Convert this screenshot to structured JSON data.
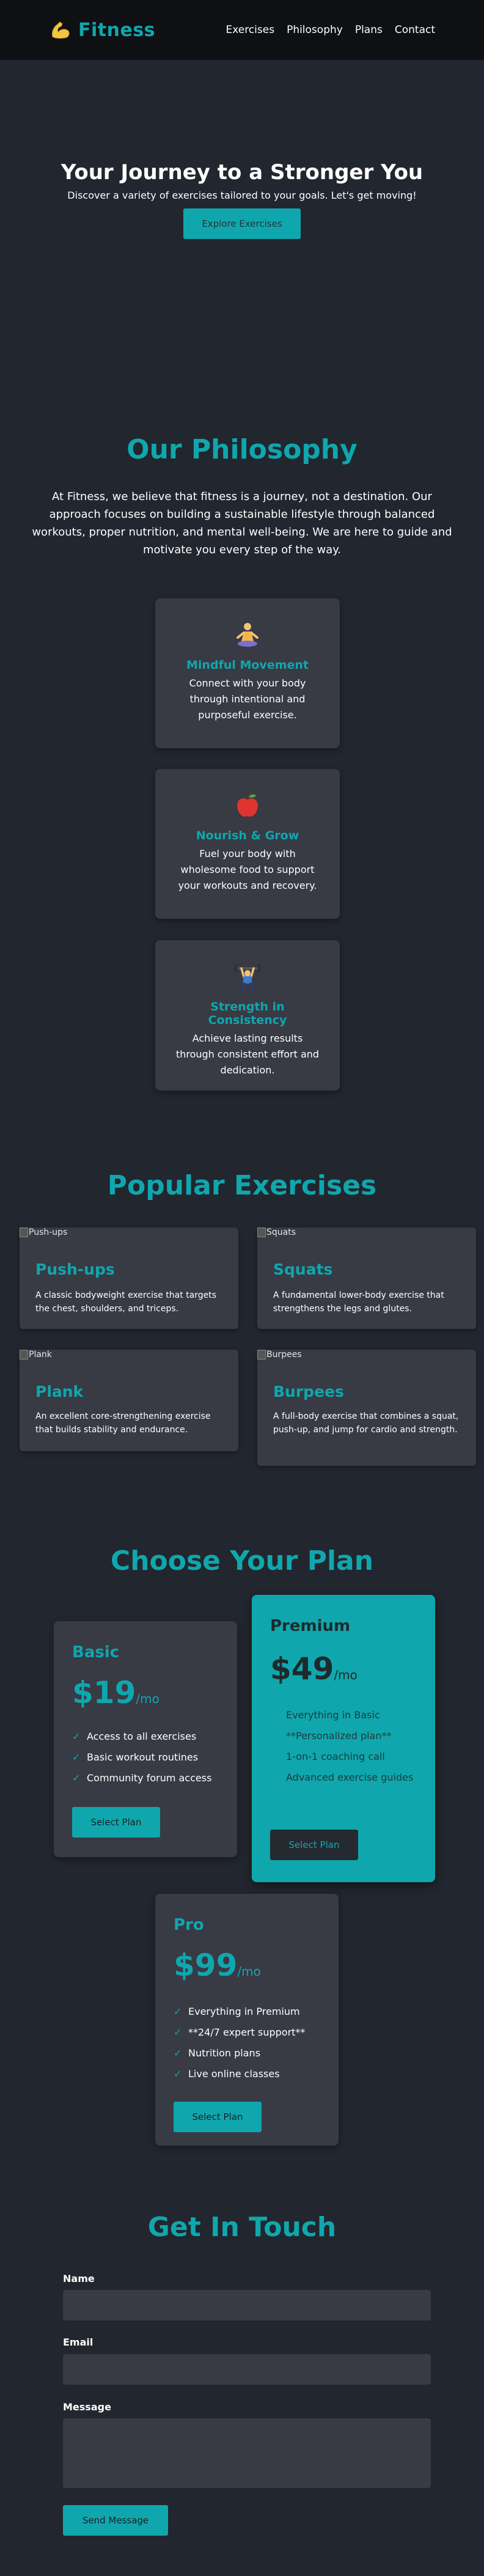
{
  "header": {
    "brand": "Fitness",
    "nav": [
      "Exercises",
      "Philosophy",
      "Plans",
      "Contact"
    ]
  },
  "hero": {
    "title": "Your Journey to a Stronger You",
    "subtitle": "Discover a variety of exercises tailored to your goals. Let's get moving!",
    "cta": "Explore Exercises"
  },
  "philosophy": {
    "title": "Our Philosophy",
    "intro": "At Fitness, we believe that fitness is a journey, not a destination. Our approach focuses on building a sustainable lifestyle through balanced workouts, proper nutrition, and mental well-being. We are here to guide and motivate you every step of the way.",
    "cards": [
      {
        "icon": "meditation-icon",
        "title": "Mindful Movement",
        "text": "Connect with your body through intentional and purposeful exercise."
      },
      {
        "icon": "apple-icon",
        "title": "Nourish & Grow",
        "text": "Fuel your body with wholesome food to support your workouts and recovery."
      },
      {
        "icon": "weightlifter-icon",
        "title": "Strength in Consistency",
        "text": "Achieve lasting results through consistent effort and dedication."
      }
    ]
  },
  "exercises": {
    "title": "Popular Exercises",
    "items": [
      {
        "alt": "Push-ups",
        "title": "Push-ups",
        "text": "A classic bodyweight exercise that targets the chest, shoulders, and triceps."
      },
      {
        "alt": "Squats",
        "title": "Squats",
        "text": "A fundamental lower-body exercise that strengthens the legs and glutes."
      },
      {
        "alt": "Plank",
        "title": "Plank",
        "text": "An excellent core-strengthening exercise that builds stability and endurance."
      },
      {
        "alt": "Burpees",
        "title": "Burpees",
        "text": "A full-body exercise that combines a squat, push-up, and jump for cardio and strength."
      }
    ]
  },
  "plans": {
    "title": "Choose Your Plan",
    "items": [
      {
        "name": "Basic",
        "price": "$19",
        "period": "/mo",
        "features": [
          "Access to all exercises",
          "Basic workout routines",
          "Community forum access"
        ],
        "button": "Select Plan"
      },
      {
        "name": "Premium",
        "price": "$49",
        "period": "/mo",
        "features": [
          "Everything in Basic",
          "**Personalized plan**",
          "1-on-1 coaching call",
          "Advanced exercise guides"
        ],
        "button": "Select Plan"
      },
      {
        "name": "Pro",
        "price": "$99",
        "period": "/mo",
        "features": [
          "Everything in Premium",
          "**24/7 expert support**",
          "Nutrition plans",
          "Live online classes"
        ],
        "button": "Select Plan"
      }
    ]
  },
  "contact": {
    "title": "Get In Touch",
    "name_label": "Name",
    "email_label": "Email",
    "message_label": "Message",
    "submit": "Send Message"
  },
  "colors": {
    "accent": "#0fa7ad",
    "background": "#22262e",
    "card": "#383a44",
    "header": "#0e1013"
  }
}
